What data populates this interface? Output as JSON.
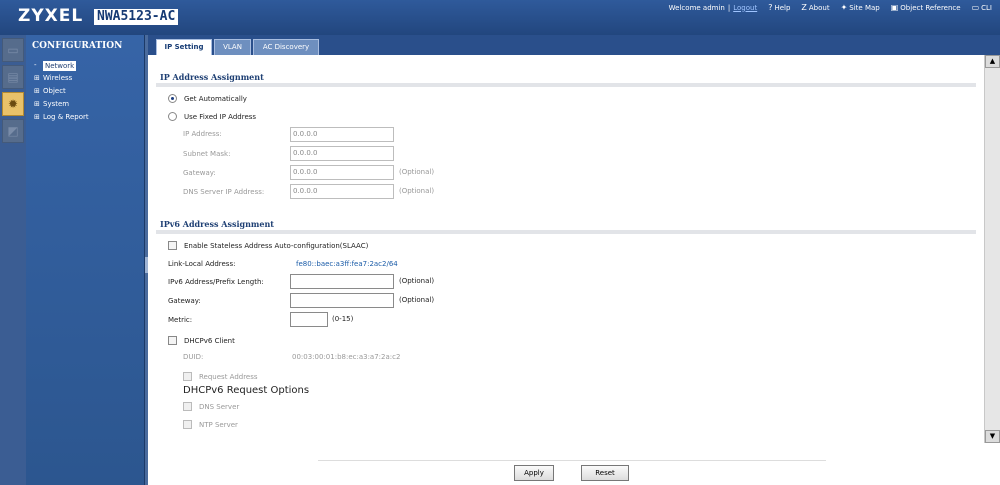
{
  "header": {
    "logo": "ZYXEL",
    "model": "NWA5123-AC",
    "welcome": "Welcome admin",
    "separator": "|",
    "logout": "Logout",
    "links": [
      {
        "icon": "?",
        "label": "Help"
      },
      {
        "icon": "Z",
        "label": "About"
      },
      {
        "icon": "✦",
        "label": "Site Map"
      },
      {
        "icon": "▣",
        "label": "Object Reference"
      },
      {
        "icon": "▭",
        "label": "CLI"
      }
    ]
  },
  "nav": {
    "title": "CONFIGURATION",
    "items": [
      {
        "expander": "-",
        "label": "Network"
      },
      {
        "expander": "⊞",
        "label": "Wireless"
      },
      {
        "expander": "⊞",
        "label": "Object"
      },
      {
        "expander": "⊞",
        "label": "System"
      },
      {
        "expander": "⊞",
        "label": "Log & Report"
      }
    ]
  },
  "tabs": [
    "IP Setting",
    "VLAN",
    "AC Discovery"
  ],
  "ipv4": {
    "title": "IP Address Assignment",
    "get_auto": "Get Automatically",
    "use_fixed": "Use Fixed IP Address",
    "ip_label": "IP Address:",
    "ip_value": "0.0.0.0",
    "mask_label": "Subnet Mask:",
    "mask_value": "0.0.0.0",
    "gw_label": "Gateway:",
    "gw_value": "0.0.0.0",
    "gw_opt": "(Optional)",
    "dns_label": "DNS Server IP Address:",
    "dns_value": "0.0.0.0",
    "dns_opt": "(Optional)"
  },
  "ipv6": {
    "title": "IPv6 Address Assignment",
    "slaac": "Enable Stateless Address Auto-configuration(SLAAC)",
    "link_local_label": "Link-Local Address:",
    "link_local_value": "fe80::baec:a3ff:fea7:2ac2/64",
    "prefix_label": "IPv6 Address/Prefix Length:",
    "prefix_value": "",
    "prefix_opt": "(Optional)",
    "gw_label": "Gateway:",
    "gw_value": "",
    "gw_opt": "(Optional)",
    "metric_label": "Metric:",
    "metric_value": "",
    "metric_range": "(0-15)",
    "dhcp_client": "DHCPv6 Client",
    "duid_label": "DUID:",
    "duid_value": "00:03:00:01:b8:ec:a3:a7:2a:c2",
    "request_address": "Request Address",
    "options_title": "DHCPv6 Request Options",
    "dns_server": "DNS Server",
    "ntp_server": "NTP Server"
  },
  "buttons": {
    "apply": "Apply",
    "reset": "Reset"
  }
}
